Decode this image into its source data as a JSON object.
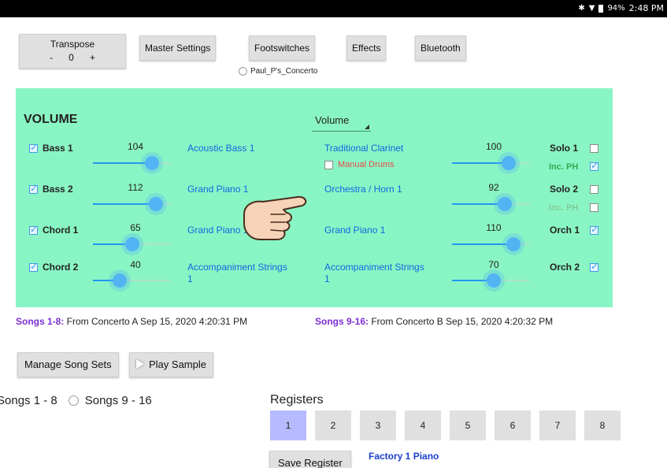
{
  "status": {
    "battery": "94%",
    "time": "2:48 PM",
    "icons": [
      "bluetooth-icon",
      "wifi-icon",
      "battery-icon"
    ]
  },
  "transpose": {
    "label": "Transpose",
    "minus": "-",
    "value": "0",
    "plus": "+"
  },
  "toolbar": {
    "master_settings": "Master Settings",
    "footswitches": "Footswitches",
    "effects": "Effects",
    "bluetooth": "Bluetooth"
  },
  "preset_name": "Paul_P's_Concerto",
  "volume": {
    "title": "VOLUME",
    "selector": "Volume",
    "rows": [
      {
        "track": "Bass 1",
        "checked": true,
        "value": "104",
        "level": 104,
        "voice": "Acoustic Bass 1",
        "voice2": "Traditional Clarinet",
        "value2": "100",
        "level2": 100,
        "right_label": "Solo 1",
        "right_checked": false
      },
      {
        "track": "Bass 2",
        "checked": true,
        "value": "112",
        "level": 112,
        "voice": "Grand Piano 1",
        "voice2": "Orchestra / Horn 1",
        "value2": "92",
        "level2": 92,
        "right_label": "Solo 2",
        "right_checked": false
      },
      {
        "track": "Chord 1",
        "checked": true,
        "value": "65",
        "level": 65,
        "voice": "Grand Piano 1",
        "voice2": "Grand Piano 1",
        "value2": "110",
        "level2": 110,
        "right_label": "Orch 1",
        "right_checked": true
      },
      {
        "track": "Chord 2",
        "checked": true,
        "value": "40",
        "level": 40,
        "voice": "Accompaniment Strings 1",
        "voice2": "Accompaniment Strings 1",
        "value2": "70",
        "level2": 70,
        "right_label": "Orch 2",
        "right_checked": true
      }
    ],
    "manual_drums": "Manual Drums",
    "inc_ph_1": "Inc. PH",
    "inc_ph_2": "Inc. PH"
  },
  "songs": {
    "left_label": "Songs 1-8:",
    "left_text": " From Concerto A Sep 15, 2020 4:20:31 PM",
    "right_label": "Songs 9-16:",
    "right_text": " From Concerto B Sep 15, 2020 4:20:32 PM"
  },
  "buttons": {
    "manage_song_sets": "Manage Song Sets",
    "play_sample": "Play Sample"
  },
  "song_sets": {
    "opt1": "Songs 1 - 8",
    "opt2": "Songs 9 - 16"
  },
  "registers": {
    "title": "Registers",
    "items": [
      "1",
      "2",
      "3",
      "4",
      "5",
      "6",
      "7",
      "8"
    ],
    "active": "1",
    "save_label": "Save Register",
    "current_name": "Factory 1 Piano"
  },
  "colors": {
    "panel": "#8af5c4",
    "voice_link": "#1565e0",
    "slider": "#2196f3",
    "song_label": "#7b2fd1"
  },
  "slider_max": 127
}
